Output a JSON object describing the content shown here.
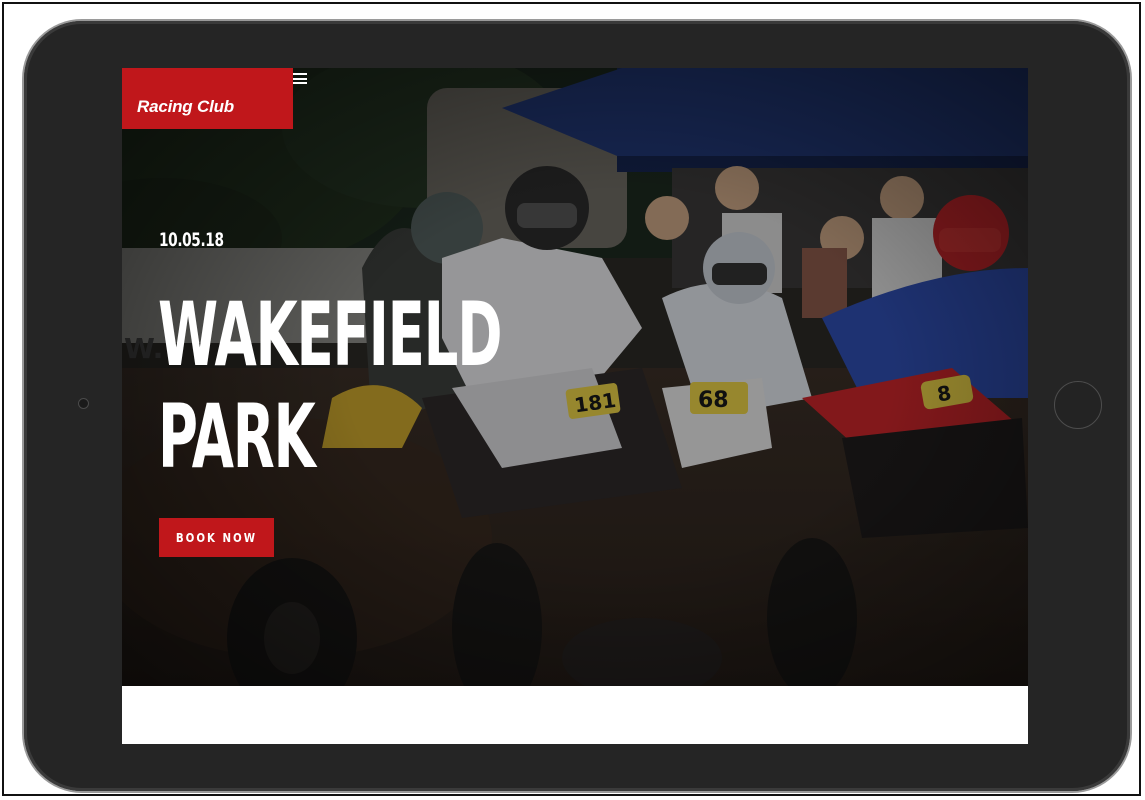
{
  "site": {
    "logo_text": "Racing Club"
  },
  "hero": {
    "date": "10.05.18",
    "title_line1": "WAKEFIELD",
    "title_line2": "PARK",
    "cta_label": "BOOK NOW"
  },
  "photo": {
    "plate_numbers": [
      "181",
      "68",
      "8"
    ],
    "sign_text": "W."
  },
  "colors": {
    "brand_red": "#c0171b",
    "tablet_body": "#252525"
  },
  "icons": {
    "menu": "hamburger-menu-icon"
  }
}
